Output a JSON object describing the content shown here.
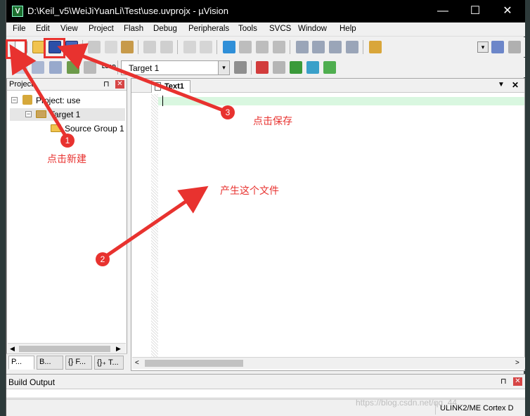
{
  "window": {
    "title": "D:\\Keil_v5\\WeiJiYuanLi\\Test\\use.uvprojx - µVision",
    "app_icon_glyph": "V",
    "minimize_glyph": "—",
    "maximize_glyph": "☐",
    "close_glyph": "✕"
  },
  "menu": [
    "File",
    "Edit",
    "View",
    "Project",
    "Flash",
    "Debug",
    "Peripherals",
    "Tools",
    "SVCS",
    "Window",
    "Help"
  ],
  "toolbar2": {
    "target_select": "Target 1",
    "load_label": "LOAD"
  },
  "project_panel": {
    "title": "Project",
    "pin_glyph": "⊓",
    "close_glyph": "✕",
    "tree": {
      "root": "Project: use",
      "target": "Target 1",
      "group": "Source Group 1",
      "collapse_glyph": "−"
    },
    "tabs": [
      "P...",
      "B...",
      "{} F...",
      "{}₊ T..."
    ]
  },
  "editor": {
    "tab": "Text1"
  },
  "build_output": {
    "title": "Build Output"
  },
  "status": {
    "debugger": "ULINK2/ME Cortex D"
  },
  "watermark": "https://blog.csdn.net/qq_44...",
  "annotations": {
    "step1_num": "1",
    "step1_text": "点击新建",
    "step2_num": "2",
    "step2_text": "产生这个文件",
    "step3_num": "3",
    "step3_text": "点击保存"
  },
  "colors": {
    "annotation_red": "#e8322f",
    "titlebar": "#000000",
    "current_line": "#d9f7e0"
  }
}
